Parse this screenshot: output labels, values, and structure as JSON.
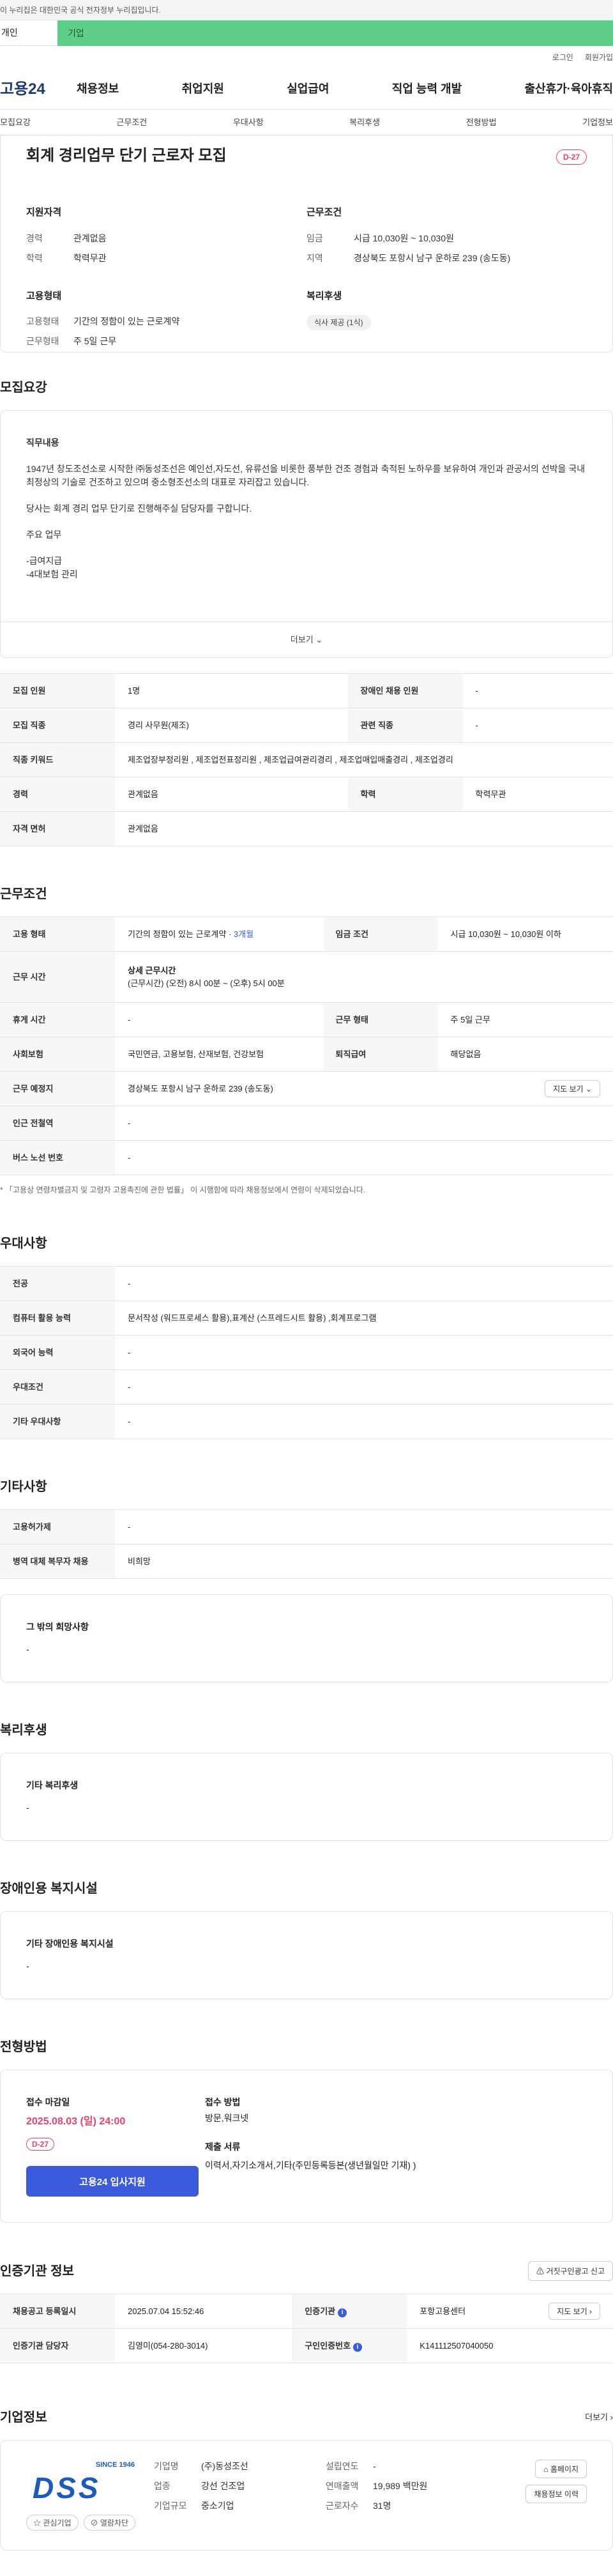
{
  "notice": "이 누리집은 대한민국 공식 전자정부 누리집입니다.",
  "type_tabs": {
    "personal": "개인",
    "company": "기업"
  },
  "util": {
    "login": "로그인",
    "join": "회원가입"
  },
  "logo": "고용24",
  "gnb": [
    "채용정보",
    "취업지원",
    "실업급여",
    "직업 능력 개발",
    "출산휴가·육아휴직"
  ],
  "subtabs": [
    "모집요강",
    "근무조건",
    "우대사항",
    "복리후생",
    "전형방법",
    "기업정보"
  ],
  "job": {
    "title": "회계 경리업무 단기 근로자 모집",
    "dday": "D-27",
    "qual_title": "지원자격",
    "qual": [
      {
        "k": "경력",
        "v": "관계없음"
      },
      {
        "k": "학력",
        "v": "학력무관"
      }
    ],
    "work_title": "근무조건",
    "work": [
      {
        "k": "임금",
        "v": "시급 10,030원 ~ 10,030원"
      },
      {
        "k": "지역",
        "v": "경상북도 포항시 남구 운하로 239 (송도동)"
      }
    ],
    "emp_title": "고용형태",
    "emp": [
      {
        "k": "고용형태",
        "v": "기간의 정함이 있는 근로계약"
      },
      {
        "k": "근무형태",
        "v": "주 5일 근무"
      }
    ],
    "welfare_title": "복리후생",
    "welfare_tag": "식사 제공 (1식)"
  },
  "recruit": {
    "title": "모집요강",
    "desc_title": "직무내용",
    "desc_p1": "1947년 창도조선소로 시작한 ㈜동성조선은 예인선,자도선, 유류선을 비롯한 풍부한 건조 경험과 축적된 노하우를 보유하여 개인과 관공서의 선박을 국내 최정상의 기술로 건조하고 있으며 중소형조선소의 대표로 자리잡고 있습니다.",
    "desc_p2": "당사는 회계 경리 업무 단기로 진행해주실 담당자를 구합니다.",
    "desc_p3": "주요 업무",
    "desc_p4": "-급여지급",
    "desc_p5": "-4대보험 관리",
    "more": "더보기",
    "rows": {
      "count_k": "모집 인원",
      "count_v": "1명",
      "dis_k": "장애인 채용 인원",
      "dis_v": "-",
      "job_k": "모집 직종",
      "job_v": "경리 사무원(제조)",
      "rel_k": "관련 직종",
      "rel_v": "-",
      "kw_k": "직종 키워드",
      "kw_v": "제조업장부정리원 , 제조업전표정리원 , 제조업급여관리경리 , 제조업매입매출경리 , 제조업경리",
      "exp_k": "경력",
      "exp_v": "관계없음",
      "edu_k": "학력",
      "edu_v": "학력무관",
      "lic_k": "자격 면허",
      "lic_v": "관계없음"
    }
  },
  "cond": {
    "title": "근무조건",
    "type_k": "고용 형태",
    "type_v": "기간의 정함이 있는 근로계약 · ",
    "type_link": "3개월",
    "wage_k": "임금 조건",
    "wage_v": "시급 10,030원 ~ 10,030원 이하",
    "time_k": "근무 시간",
    "time_t": "상세 근무시간",
    "time_v": "(근무시간) (오전) 8시 00분 ~ (오후) 5시 00분",
    "rest_k": "휴게 시간",
    "rest_v": "-",
    "form_k": "근무 형태",
    "form_v": "주 5일 근무",
    "ins_k": "사회보험",
    "ins_v": "국민연금, 고용보험, 산재보험, 건강보험",
    "ret_k": "퇴직급여",
    "ret_v": "해당없음",
    "loc_k": "근무 예정지",
    "loc_v": "경상북도 포항시 남구 운하로 239 (송도동)",
    "map": "지도 보기",
    "sub_k": "인근 전철역",
    "sub_v": "-",
    "bus_k": "버스 노선 번호",
    "bus_v": "-",
    "note": "「고용상 연령차별금지 및 고령자 고용촉진에 관한 법률」 이 시행함에 따라 채용정보에서 연령이 삭제되었습니다."
  },
  "pref": {
    "title": "우대사항",
    "major_k": "전공",
    "major_v": "-",
    "pc_k": "컴퓨터 활용 능력",
    "pc_v": "문서작성 (워드프로세스 활용),표계산 (스프레드시트 활용) ,회계프로그램",
    "lang_k": "외국어 능력",
    "lang_v": "-",
    "cond_k": "우대조건",
    "cond_v": "-",
    "etc_k": "기타 우대사항",
    "etc_v": "-"
  },
  "other": {
    "title": "기타사항",
    "permit_k": "고용허가제",
    "permit_v": "-",
    "mil_k": "병역 대체 복무자 채용",
    "mil_v": "비희망",
    "wish_t": "그 밖의 희망사항",
    "wish_v": "-"
  },
  "welfare": {
    "title": "복리후생",
    "t": "기타 복리후생",
    "v": "-"
  },
  "disab": {
    "title": "장애인용 복지시설",
    "t": "기타 장애인용 복지시설",
    "v": "-"
  },
  "select": {
    "title": "전형방법",
    "dl_t": "접수 마감일",
    "dl_v": "2025.08.03 (일) 24:00",
    "dday": "D-27",
    "apply": "고용24 입사지원",
    "method_t": "접수 방법",
    "method_v": "방문,워크넷",
    "docs_t": "제출 서류",
    "docs_v": "이력서,자기소개서,기타(주민등록등본(생년월일만 기재) )"
  },
  "cert": {
    "title": "인증기관 정보",
    "report": "거짓구인광고 신고",
    "date_k": "채용공고 등록일시",
    "date_v": "2025.07.04 15:52:46",
    "org_k": "인증기관",
    "org_v": "포항고용센터",
    "map": "지도 보기",
    "mgr_k": "인증기관 담당자",
    "mgr_v": "김영미(054-280-3014)",
    "no_k": "구인인증번호",
    "no_v": "K141112507040050"
  },
  "company": {
    "title": "기업정보",
    "more": "더보기",
    "logo_text": "DSS",
    "logo_since": "SINCE 1946",
    "name_k": "기업명",
    "name_v": "(주)동성조선",
    "est_k": "설립연도",
    "est_v": "-",
    "ind_k": "업종",
    "ind_v": "강선 건조업",
    "sales_k": "연매출액",
    "sales_v": "19,989 백만원",
    "size_k": "기업규모",
    "size_v": "중소기업",
    "emp_k": "근로자수",
    "emp_v": "31명",
    "home": "홈페이지",
    "hist": "채용정보 이력",
    "fav": "관심기업",
    "block": "열람차단"
  },
  "colors": {
    "accent": "#3b5bdb",
    "dday": "#e8436b",
    "green": "#5fce8a"
  }
}
